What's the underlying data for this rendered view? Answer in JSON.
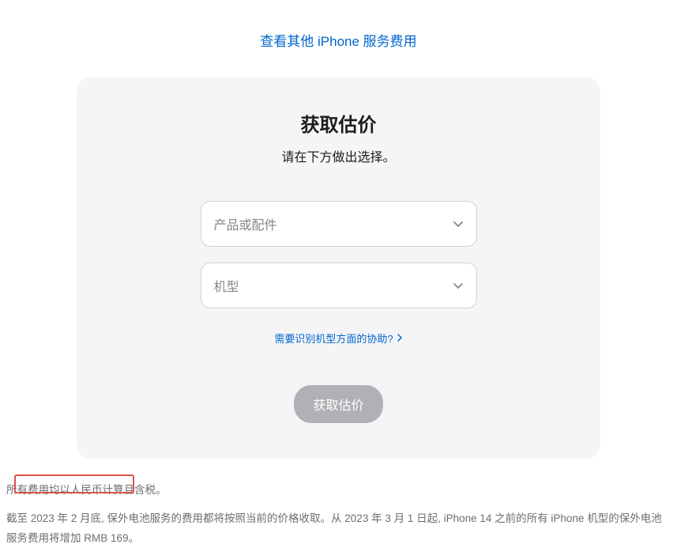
{
  "top_link": "查看其他 iPhone 服务费用",
  "card": {
    "title": "获取估价",
    "subtitle": "请在下方做出选择。",
    "select_product_placeholder": "产品或配件",
    "select_model_placeholder": "机型",
    "help_link": "需要识别机型方面的协助?",
    "submit_button": "获取估价"
  },
  "footnote": {
    "line1": "所有费用均以人民币计算且含税。",
    "line2": "截至 2023 年 2 月底, 保外电池服务的费用都将按照当前的价格收取。从 2023 年 3 月 1 日起, iPhone 14 之前的所有 iPhone 机型的保外电池服务费用将增加 RMB 169。"
  }
}
